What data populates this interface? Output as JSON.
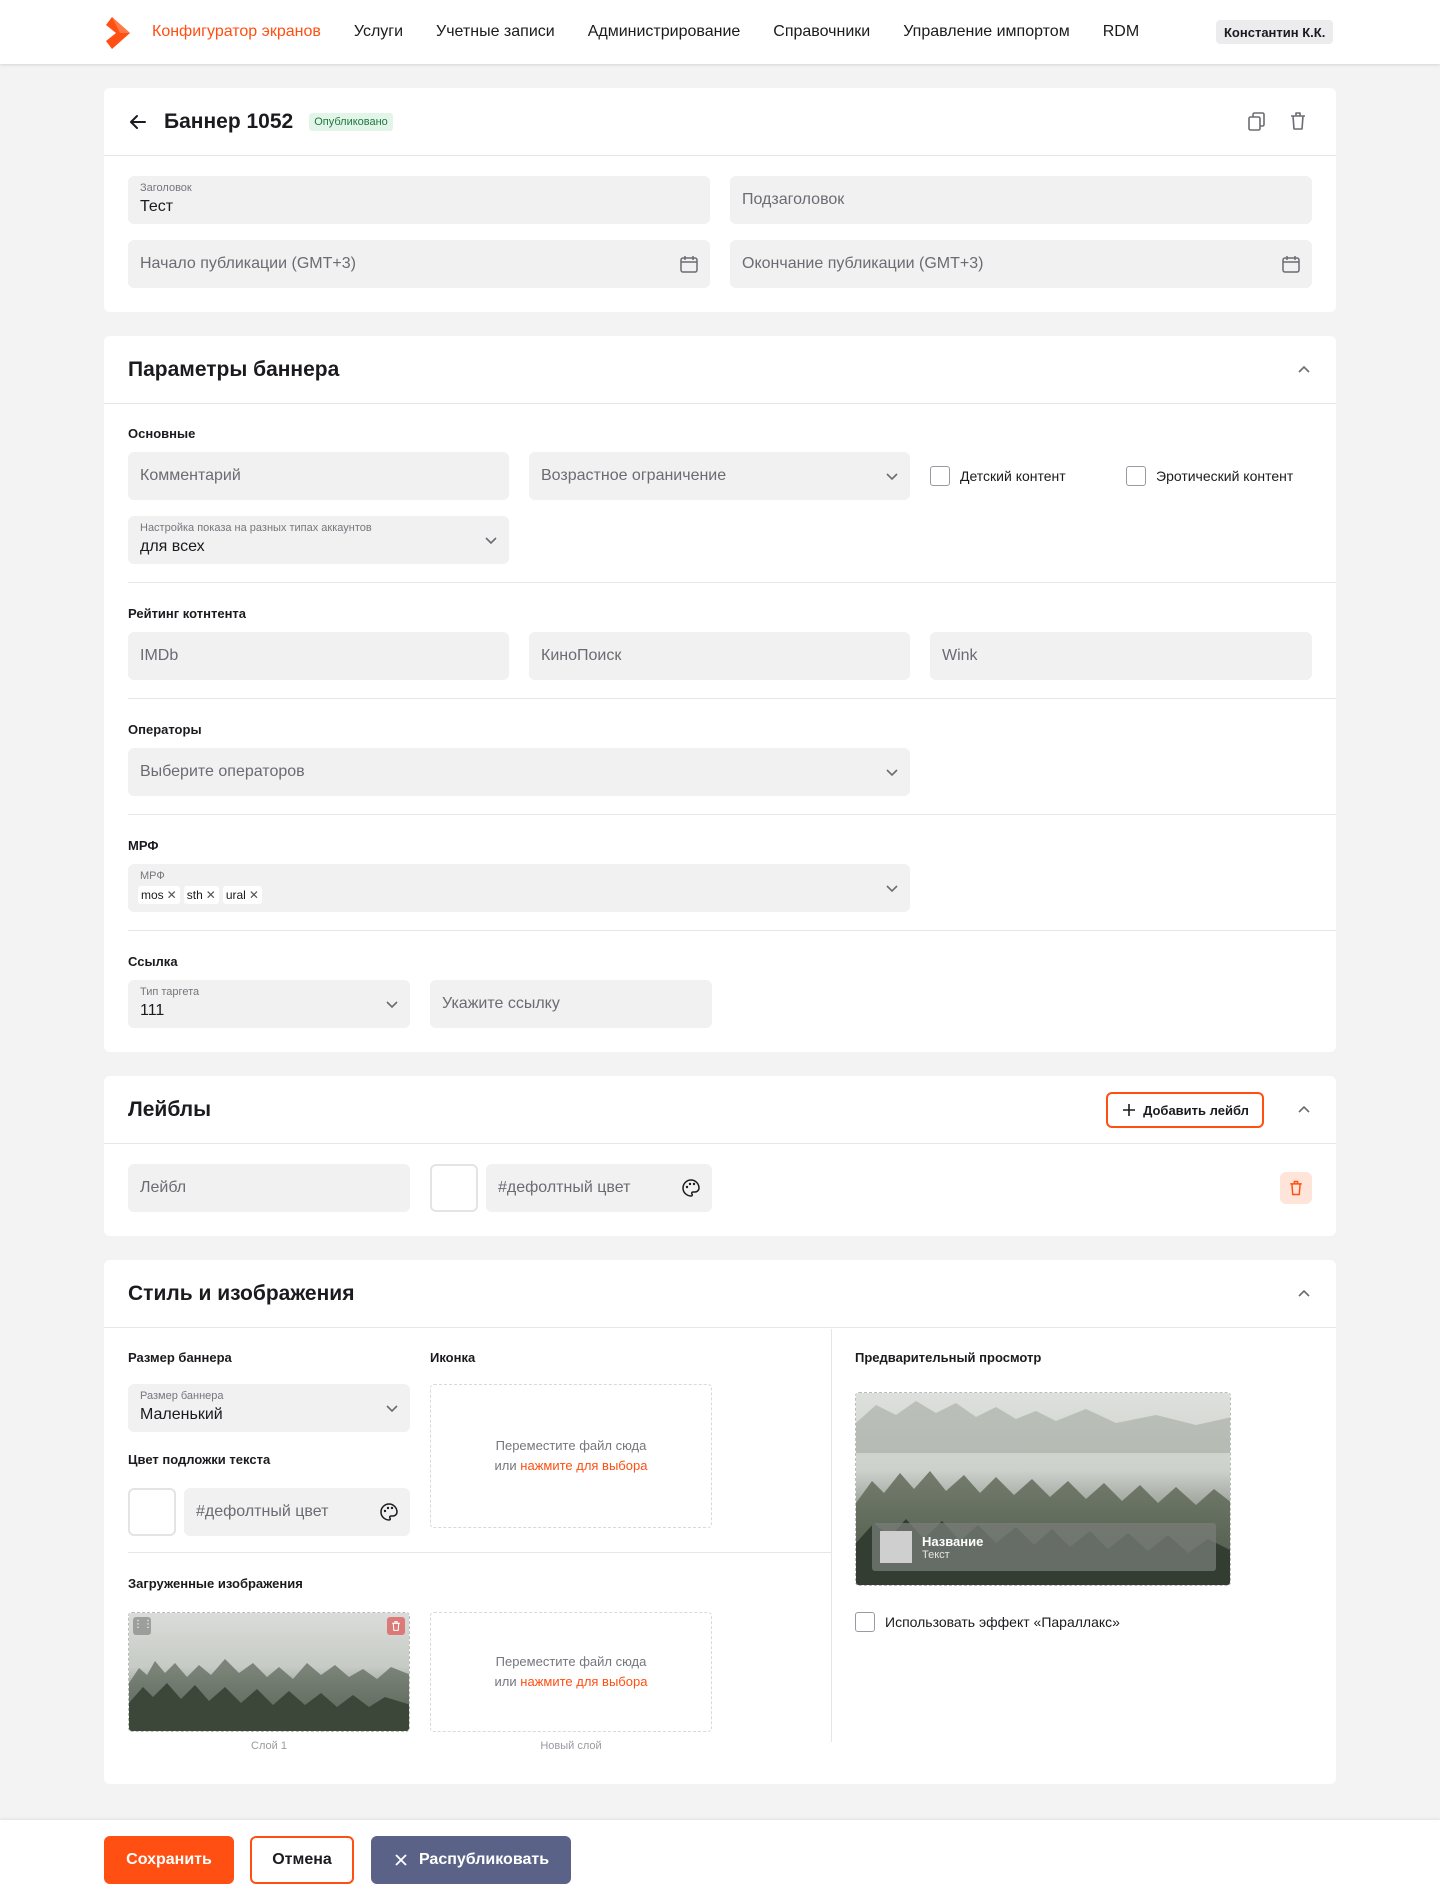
{
  "nav": {
    "items": [
      "Конфигуратор экранов",
      "Услуги",
      "Учетные записи",
      "Администрирование",
      "Справочники",
      "Управление импортом",
      "RDM"
    ],
    "user": "Константин К.К."
  },
  "banner": {
    "title": "Баннер 1052",
    "status": "Опубликовано",
    "headline_label": "Заголовок",
    "headline_value": "Тест",
    "subheadline_placeholder": "Подзаголовок",
    "start_placeholder": "Начало публикации (GMT+3)",
    "end_placeholder": "Окончание публикации (GMT+3)"
  },
  "params": {
    "title": "Параметры баннера",
    "basic_label": "Основные",
    "comment_placeholder": "Комментарий",
    "age_placeholder": "Возрастное ограничение",
    "kids_label": "Детский контент",
    "erotic_label": "Эротический контент",
    "accounts_label": "Настройка показа на разных типах аккаунтов",
    "accounts_value": "для всех",
    "rating_label": "Рейтинг котнтента",
    "imdb_placeholder": "IMDb",
    "kinopoisk_placeholder": "КиноПоиск",
    "wink_placeholder": "Wink",
    "operators_label": "Операторы",
    "operators_placeholder": "Выберите операторов",
    "mrf_label": "МРФ",
    "mrf_field_label": "МРФ",
    "mrf_chips": [
      "mos",
      "sth",
      "ural"
    ],
    "link_label": "Ссылка",
    "target_type_label": "Тип таргета",
    "target_type_value": "111",
    "link_placeholder": "Укажите ссылку"
  },
  "labels": {
    "title": "Лейблы",
    "add_button": "Добавить лейбл",
    "label_placeholder": "Лейбл",
    "color_placeholder": "#дефолтный цвет"
  },
  "style": {
    "title": "Стиль и изображения",
    "size_label": "Размер баннера",
    "size_field_label": "Размер баннера",
    "size_value": "Маленький",
    "icon_label": "Иконка",
    "drop_text": "Переместите файл сюда",
    "drop_or": "или ",
    "drop_link": "нажмите для выбора",
    "bg_color_label": "Цвет подложки текста",
    "bg_color_placeholder": "#дефолтный цвет",
    "uploaded_label": "Загруженные изображения",
    "layer1_caption": "Слой 1",
    "new_layer_caption": "Новый слой",
    "preview_label": "Предварительный просмотр",
    "preview_name": "Название",
    "preview_text": "Текст",
    "parallax_label": "Использовать эффект «Параллакс»"
  },
  "actions": {
    "save": "Сохранить",
    "cancel": "Отмена",
    "republish": "Распубликовать"
  },
  "colors": {
    "accent": "#ff4f12",
    "republish": "#5a6387",
    "status_bg": "#e3f5e9",
    "status_fg": "#1f7a3f"
  }
}
